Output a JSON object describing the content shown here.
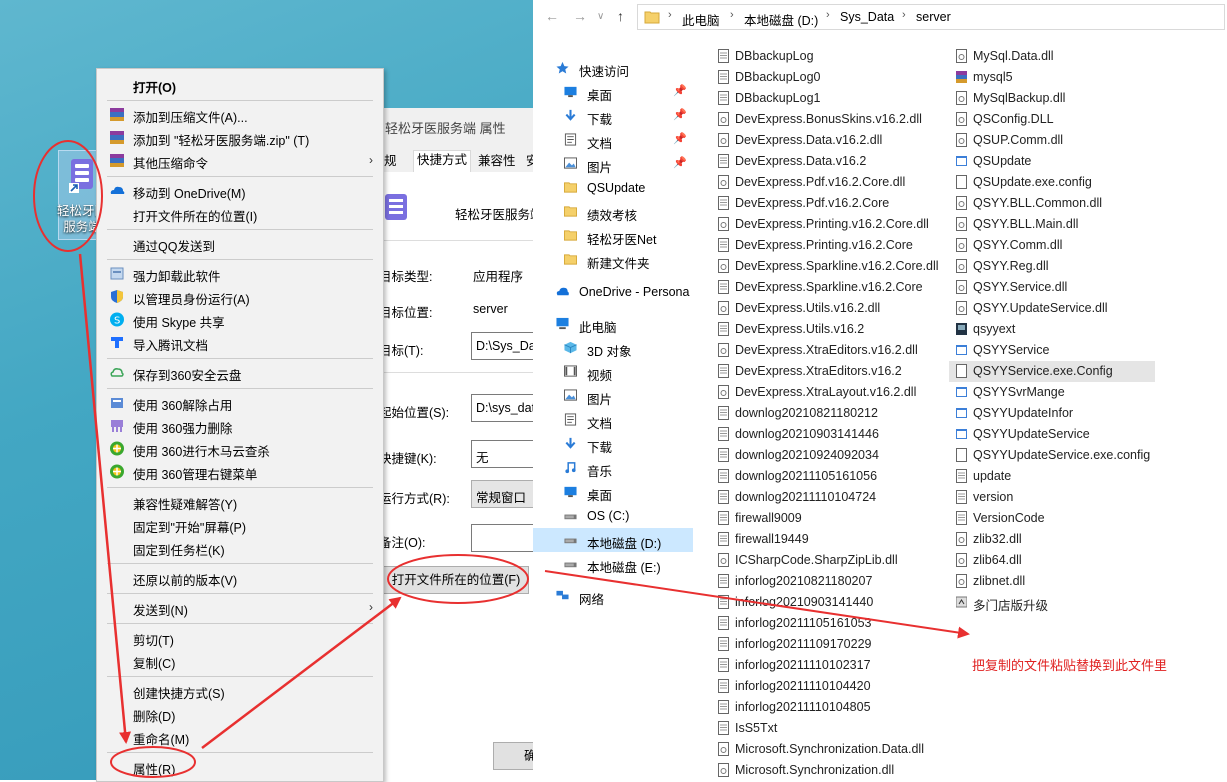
{
  "desktop": {
    "icon_label": "轻松牙医服务端"
  },
  "properties": {
    "title": "轻松牙医服务端 属性",
    "tabs": [
      "规",
      "快捷方式",
      "兼容性",
      "安"
    ],
    "app_name": "轻松牙医服务端",
    "target_type_label": "目标类型:",
    "target_type_value": "应用程序",
    "target_location_label": "目标位置:",
    "target_location_value": "server",
    "target_label": "目标(T):",
    "target_value": "D:\\Sys_Data",
    "start_in_label": "起始位置(S):",
    "start_in_value": "D:\\sys_data",
    "shortcut_key_label": "快捷键(K):",
    "shortcut_key_value": "无",
    "run_label": "运行方式(R):",
    "run_value": "常规窗口",
    "comment_label": "备注(O):",
    "open_location_button": "打开文件所在的位置(F)",
    "ok_button": "确"
  },
  "context_menu": {
    "open": "打开(O)",
    "add_archive": "添加到压缩文件(A)...",
    "add_zip": "添加到 \"轻松牙医服务端.zip\" (T)",
    "other_compress": "其他压缩命令",
    "move_onedrive": "移动到 OneDrive(M)",
    "open_location": "打开文件所在的位置(I)",
    "send_qq": "通过QQ发送到",
    "force_uninstall": "强力卸载此软件",
    "run_admin": "以管理员身份运行(A)",
    "skype_share": "使用 Skype 共享",
    "tencent_doc": "导入腾讯文档",
    "save_360": "保存到360安全云盘",
    "unlock_360": "使用 360解除占用",
    "force_delete_360": "使用 360强力删除",
    "trojan_360": "使用 360进行木马云查杀",
    "rightmenu_360": "使用 360管理右键菜单",
    "compat": "兼容性疑难解答(Y)",
    "pin_start": "固定到\"开始\"屏幕(P)",
    "pin_taskbar": "固定到任务栏(K)",
    "restore": "还原以前的版本(V)",
    "send_to": "发送到(N)",
    "cut": "剪切(T)",
    "copy": "复制(C)",
    "create_shortcut": "创建快捷方式(S)",
    "delete": "删除(D)",
    "rename": "重命名(M)",
    "properties": "属性(R)"
  },
  "explorer": {
    "breadcrumb": [
      "此电脑",
      "本地磁盘 (D:)",
      "Sys_Data",
      "server"
    ],
    "tree": [
      "快速访问",
      "桌面",
      "下载",
      "文档",
      "图片",
      "QSUpdate",
      "绩效考核",
      "轻松牙医Net",
      "新建文件夹",
      "OneDrive - Persona",
      "此电脑",
      "3D 对象",
      "视频",
      "图片",
      "文档",
      "下载",
      "音乐",
      "桌面",
      "OS (C:)",
      "本地磁盘 (D:)",
      "本地磁盘 (E:)",
      "网络"
    ],
    "files_col1": [
      "DBbackupLog",
      "DBbackupLog0",
      "DBbackupLog1",
      "DevExpress.BonusSkins.v16.2.dll",
      "DevExpress.Data.v16.2.dll",
      "DevExpress.Data.v16.2",
      "DevExpress.Pdf.v16.2.Core.dll",
      "DevExpress.Pdf.v16.2.Core",
      "DevExpress.Printing.v16.2.Core.dll",
      "DevExpress.Printing.v16.2.Core",
      "DevExpress.Sparkline.v16.2.Core.dll",
      "DevExpress.Sparkline.v16.2.Core",
      "DevExpress.Utils.v16.2.dll",
      "DevExpress.Utils.v16.2",
      "DevExpress.XtraEditors.v16.2.dll",
      "DevExpress.XtraEditors.v16.2",
      "DevExpress.XtraLayout.v16.2.dll",
      "downlog20210821180212",
      "downlog20210903141446",
      "downlog20210924092034",
      "downlog20211105161056",
      "downlog20211110104724",
      "firewall9009",
      "firewall19449",
      "ICSharpCode.SharpZipLib.dll",
      "inforlog20210821180207",
      "inforlog20210903141440",
      "inforlog20211105161053",
      "inforlog20211109170229",
      "inforlog20211110102317",
      "inforlog20211110104420",
      "inforlog20211110104805",
      "IsS5Txt",
      "Microsoft.Synchronization.Data.dll",
      "Microsoft.Synchronization.dll"
    ],
    "files_col2": [
      "MySql.Data.dll",
      "mysql5",
      "MySqlBackup.dll",
      "QSConfig.DLL",
      "QSUP.Comm.dll",
      "QSUpdate",
      "QSUpdate.exe.config",
      "QSYY.BLL.Common.dll",
      "QSYY.BLL.Main.dll",
      "QSYY.Comm.dll",
      "QSYY.Reg.dll",
      "QSYY.Service.dll",
      "QSYY.UpdateService.dll",
      "qsyyext",
      "QSYYService",
      "QSYYService.exe.Config",
      "QSYYSvrMange",
      "QSYYUpdateInfor",
      "QSYYUpdateService",
      "QSYYUpdateService.exe.config",
      "update",
      "version",
      "VersionCode",
      "zlib32.dll",
      "zlib64.dll",
      "zlibnet.dll",
      "多门店版升级"
    ]
  },
  "annotation": {
    "note": "把复制的文件粘贴替换到此文件里"
  },
  "colors": {
    "arrow": "#e83030",
    "selection": "#cce8ff",
    "folder": "#f5d06a"
  }
}
